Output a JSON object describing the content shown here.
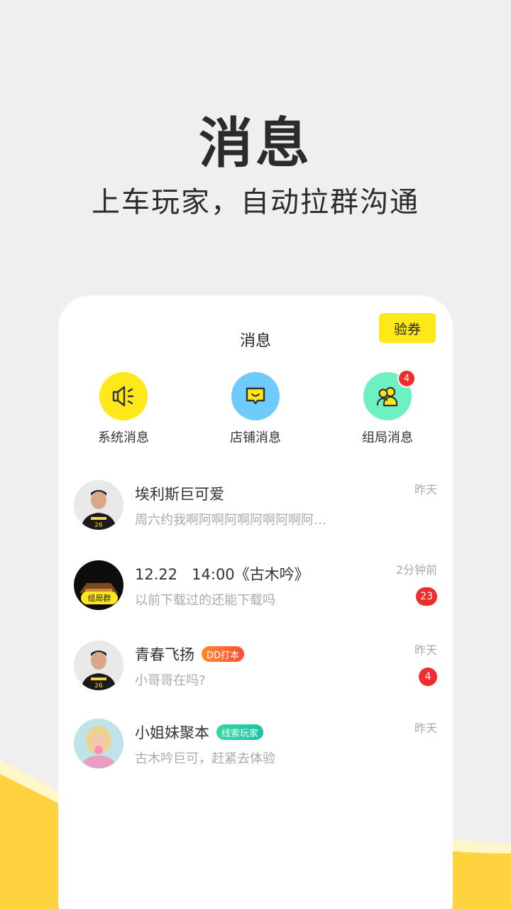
{
  "hero": {
    "title": "消息",
    "subtitle": "上车玩家，自动拉群沟通"
  },
  "header": {
    "title": "消息",
    "coupon_button": "验券"
  },
  "categories": [
    {
      "label": "系统消息",
      "icon": "speaker-icon",
      "color": "#ffe81a"
    },
    {
      "label": "店铺消息",
      "icon": "chat-bubble-icon",
      "color": "#6fcbfb"
    },
    {
      "label": "组局消息",
      "icon": "group-users-icon",
      "color": "#6ff0c0",
      "badge": "4"
    }
  ],
  "chats": [
    {
      "name": "埃利斯巨可爱",
      "preview": "周六约我啊阿啊阿啊阿啊阿啊阿…",
      "time": "昨天"
    },
    {
      "name": "12.22   14:00《古木吟》",
      "preview": "以前下载过的还能下载吗",
      "time": "2分钟前",
      "unread": "23",
      "avatar_tag": "组局群"
    },
    {
      "name": "青春飞扬",
      "tag": "DD打本",
      "preview": "小哥哥在吗?",
      "time": "昨天",
      "unread": "4"
    },
    {
      "name": "小姐妹聚本",
      "tag": "线索玩家",
      "preview": "古木吟巨可，赶紧去体验",
      "time": "昨天"
    }
  ]
}
